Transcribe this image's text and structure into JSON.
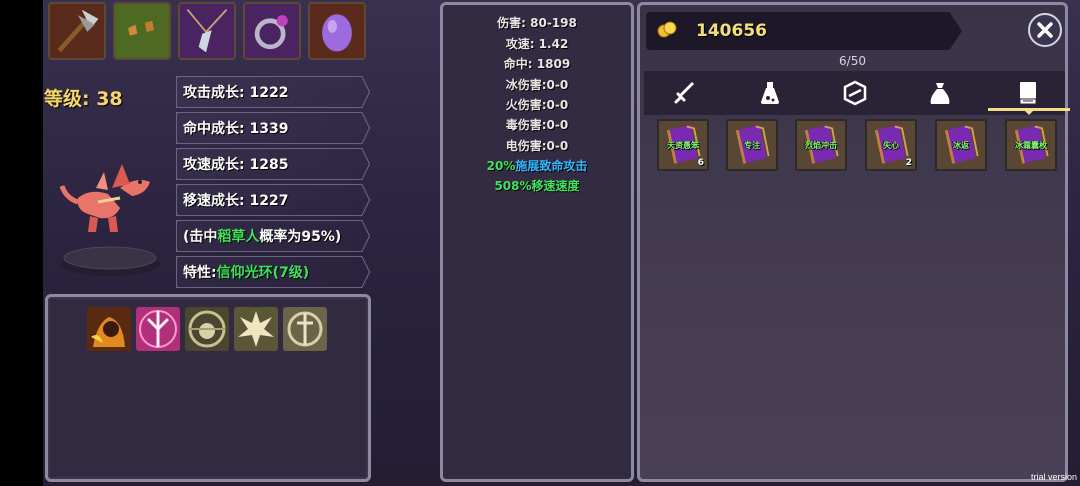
{
  "equipment": [
    {
      "icon": "axe-icon"
    },
    {
      "icon": "leaf-fragment-icon"
    },
    {
      "icon": "feather-necklace-icon"
    },
    {
      "icon": "ring-icon"
    },
    {
      "icon": "purple-egg-icon"
    }
  ],
  "level_text": "等级: 38",
  "growth_stats": [
    {
      "label": "攻击成长: 1222"
    },
    {
      "label": "命中成长: 1339"
    },
    {
      "label": "攻速成长: 1285"
    },
    {
      "label": "移速成长: 1227"
    }
  ],
  "proc": {
    "prefix": "(击中",
    "highlight": "稻草人",
    "suffix": "概率为95%)"
  },
  "trait": {
    "prefix": "特性:",
    "highlight": "信仰光环",
    "suffix": "(7级)"
  },
  "pet_icon": "dragon-icon",
  "skills": [
    {
      "icon": "fire-beast-skill-icon"
    },
    {
      "icon": "pink-trident-skill-icon"
    },
    {
      "icon": "skull-ward-skill-icon"
    },
    {
      "icon": "spiky-burst-skill-icon"
    },
    {
      "icon": "sword-crest-skill-icon"
    }
  ],
  "stats": [
    {
      "text": "伤害: 80-198"
    },
    {
      "text": "攻速: 1.42"
    },
    {
      "text": "命中: 1809"
    },
    {
      "text": "冰伤害:0-0"
    },
    {
      "text": "火伤害:0-0"
    },
    {
      "text": "毒伤害:0-0"
    },
    {
      "text": "电伤害:0-0"
    }
  ],
  "bonus_crit": {
    "percent": "20%",
    "text": "施展致命攻击"
  },
  "bonus_speed": {
    "text": "508%移速速度"
  },
  "gold": "140656",
  "capacity": "6/50",
  "tabs": [
    {
      "icon": "sword-icon"
    },
    {
      "icon": "potion-icon"
    },
    {
      "icon": "gem-icon"
    },
    {
      "icon": "bag-icon"
    },
    {
      "icon": "book-icon",
      "active": true
    }
  ],
  "items": [
    {
      "label": "天资愚笨",
      "count": "6"
    },
    {
      "label": "专注",
      "count": ""
    },
    {
      "label": "烈焰冲击",
      "count": ""
    },
    {
      "label": "失心",
      "count": "2"
    },
    {
      "label": "冰返",
      "count": ""
    },
    {
      "label": "冰霜囊枚",
      "count": ""
    }
  ],
  "colors": {
    "accent": "#f4e07a",
    "green": "#3fe25c",
    "cyan": "#34b8ff"
  },
  "watermark": "trial version"
}
